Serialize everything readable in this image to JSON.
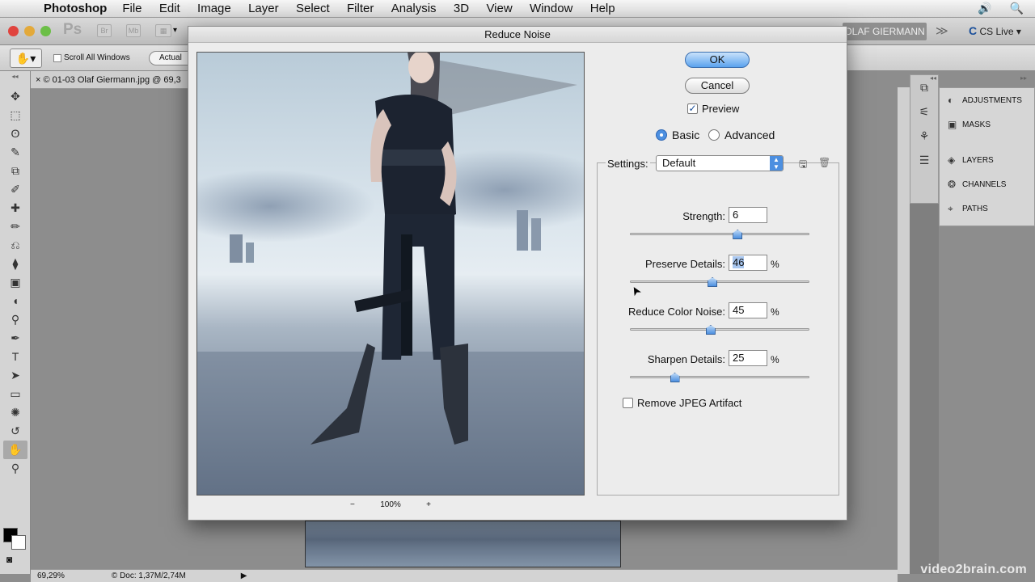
{
  "menubar": {
    "apple": "",
    "app_name": "Photoshop",
    "menus": [
      "File",
      "Edit",
      "Image",
      "Layer",
      "Select",
      "Filter",
      "Analysis",
      "3D",
      "View",
      "Window",
      "Help"
    ],
    "speaker_icon": "🔊",
    "search_icon": "🔍"
  },
  "appbar": {
    "ps_logo": "Ps",
    "workspace": "OLAF GIERMANN",
    "chevron": "≫",
    "cslive": "CS Live",
    "cslive_icon": "C",
    "dropdown": "▾",
    "br": "Br",
    "mb": "Mb"
  },
  "options": {
    "scroll_all": "Scroll All Windows",
    "actual_pixels": "Actual Pixels",
    "hand_icon": "✋"
  },
  "document": {
    "tab_title": "© 01-03 Olaf Giermann.jpg @ 69,3",
    "close_icon": "×"
  },
  "tools": [
    "✥",
    "⬚",
    "ʘ",
    "✎",
    "⧉",
    "✐",
    "✚",
    "✏",
    "⎌",
    "⧫",
    "▣",
    "◖",
    "⚲",
    "✒",
    "T",
    "➤",
    "▭",
    "✺",
    "↺",
    "✋",
    "⚲"
  ],
  "dialog": {
    "title": "Reduce Noise",
    "ok": "OK",
    "cancel": "Cancel",
    "preview_label": "Preview",
    "preview_checked": true,
    "mode_basic": "Basic",
    "mode_advanced": "Advanced",
    "mode_selected": "Basic",
    "settings_label": "Settings:",
    "settings_value": "Default",
    "zoom_minus": "−",
    "zoom_value": "100%",
    "zoom_plus": "+",
    "strength_label": "Strength:",
    "strength_value": "6",
    "preserve_label": "Preserve Details:",
    "preserve_value": "46",
    "color_noise_label": "Reduce Color Noise:",
    "color_noise_value": "45",
    "sharpen_label": "Sharpen Details:",
    "sharpen_value": "25",
    "percent": "%",
    "remove_jpeg_label": "Remove JPEG Artifact",
    "remove_jpeg_checked": false,
    "slider_levels": {
      "strength": 0.6,
      "preserve": 0.46,
      "color_noise": 0.45,
      "sharpen": 0.25
    }
  },
  "dock": {
    "panels": [
      "ADJUSTMENTS",
      "MASKS",
      "LAYERS",
      "CHANNELS",
      "PATHS"
    ],
    "collapse_icon": "◂◂"
  },
  "status": {
    "zoom": "69,29%",
    "doc": "© Doc: 1,37M/2,74M",
    "arrow": "▶"
  },
  "watermark": "video2brain.com",
  "colors": {
    "accent": "#4c8fe0",
    "dialog_bg": "#ececec"
  }
}
